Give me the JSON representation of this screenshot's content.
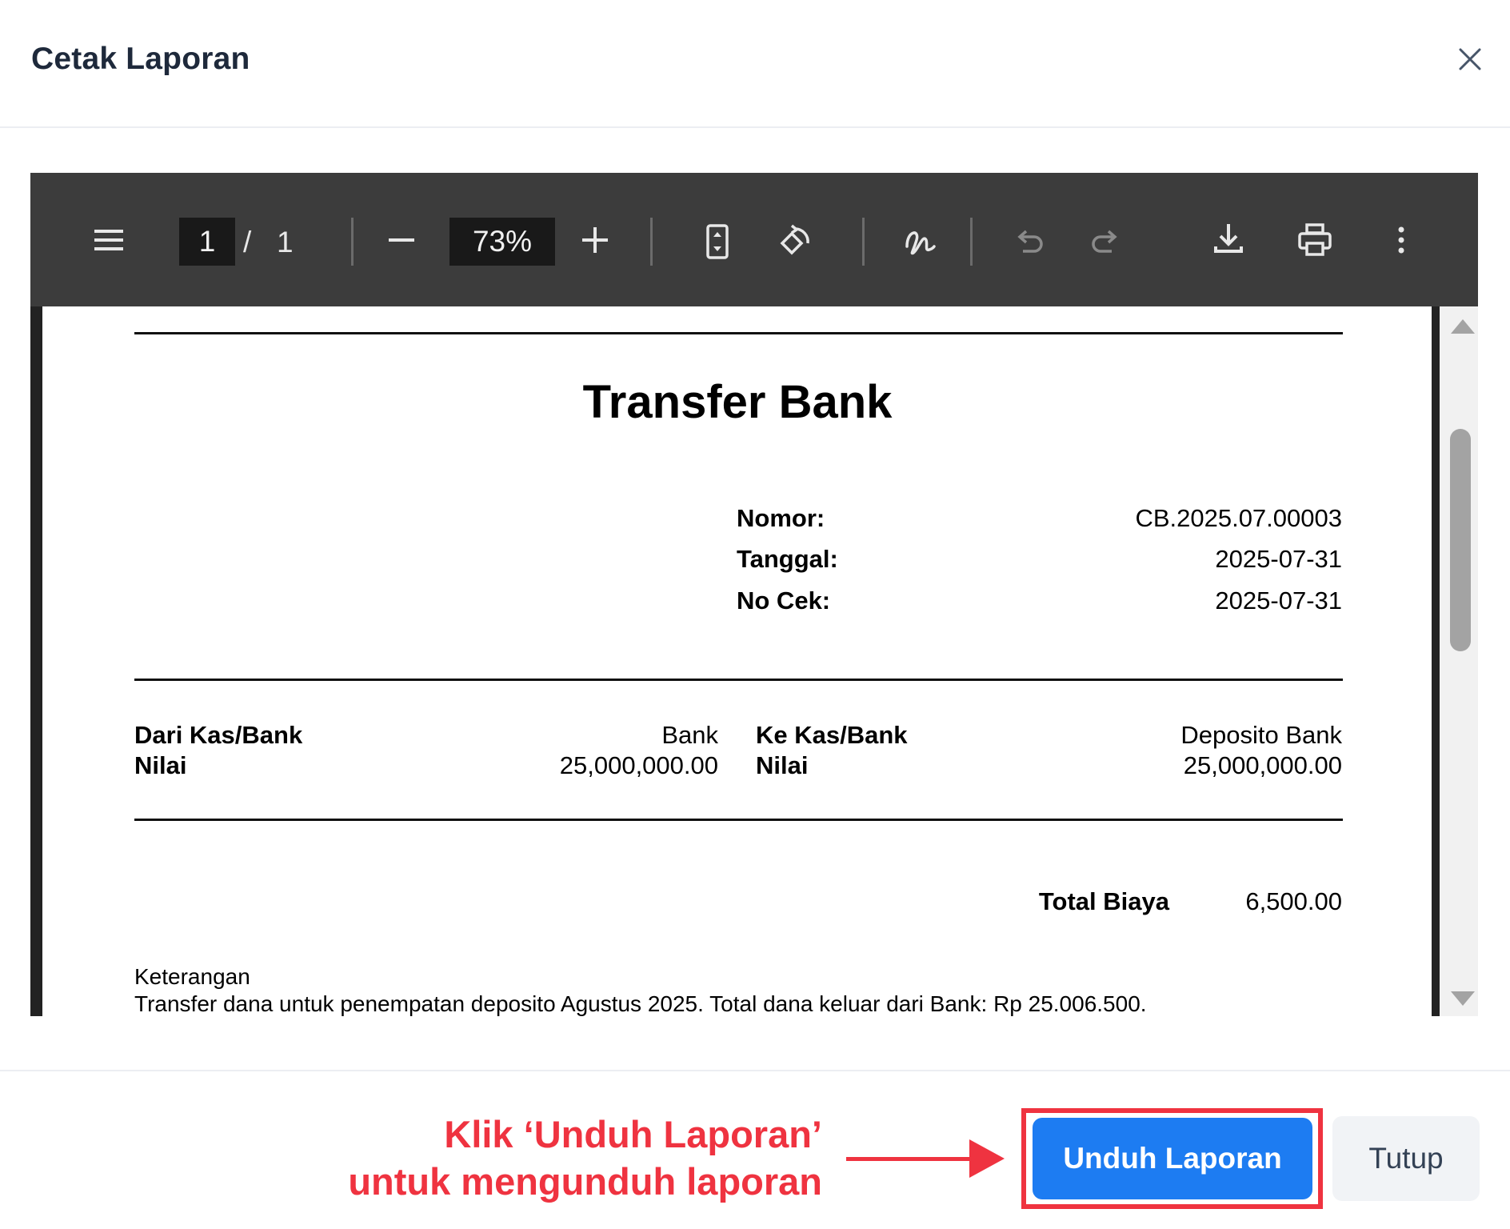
{
  "modal": {
    "title": "Cetak Laporan",
    "close_icon": "close-icon"
  },
  "viewer": {
    "current_page": "1",
    "page_separator": "/",
    "total_pages": "1",
    "zoom": "73%",
    "icons": {
      "menu": "menu-icon",
      "zoom_out": "minus-icon",
      "zoom_in": "plus-icon",
      "fit_page": "fit-page-icon",
      "rotate": "rotate-icon",
      "annotate": "pen-icon",
      "undo": "undo-icon",
      "redo": "redo-icon",
      "download": "download-icon",
      "print": "print-icon",
      "more": "more-vertical-icon"
    }
  },
  "document": {
    "title": "Transfer Bank",
    "meta": [
      {
        "label": "Nomor:",
        "value": "CB.2025.07.00003"
      },
      {
        "label": "Tanggal:",
        "value": "2025-07-31"
      },
      {
        "label": "No Cek:",
        "value": "2025-07-31"
      }
    ],
    "from": {
      "account_label": "Dari Kas/Bank",
      "account_value": "Bank",
      "amount_label": "Nilai",
      "amount_value": "25,000,000.00"
    },
    "to": {
      "account_label": "Ke Kas/Bank",
      "account_value": "Deposito Bank",
      "amount_label": "Nilai",
      "amount_value": "25,000,000.00"
    },
    "total_fee": {
      "label": "Total Biaya",
      "value": "6,500.00"
    },
    "notes_label": "Keterangan",
    "notes_text": "Transfer dana untuk penempatan deposito Agustus 2025. Total dana keluar dari Bank: Rp 25.006.500."
  },
  "footer": {
    "annotation_line1": "Klik ‘Unduh Laporan’",
    "annotation_line2": "untuk mengunduh laporan",
    "download_button": "Unduh Laporan",
    "close_button": "Tutup"
  },
  "colors": {
    "primary": "#1d7cf2",
    "annotation": "#ef3340",
    "toolbar": "#3c3c3c"
  }
}
